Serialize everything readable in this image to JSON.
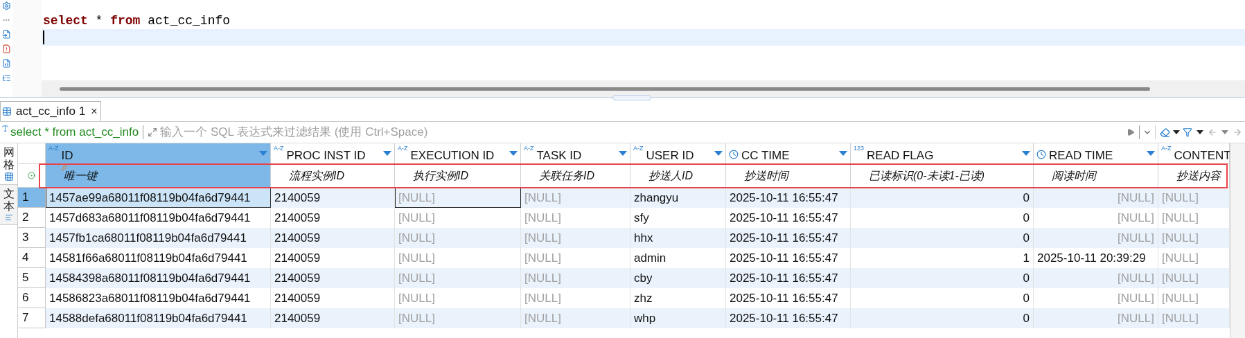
{
  "editor": {
    "lines": [
      [
        {
          "kind": "keyword",
          "text": "select"
        },
        {
          "kind": "plain",
          "text": " * "
        },
        {
          "kind": "keyword",
          "text": "from"
        },
        {
          "kind": "plain",
          "text": " act_cc_info"
        }
      ]
    ]
  },
  "results_tab": {
    "label": "act_cc_info 1",
    "close": "×"
  },
  "filter": {
    "query": "select * from act_cc_info",
    "placeholder": "输入一个 SQL 表达式来过滤结果 (使用 Ctrl+Space)"
  },
  "view_tabs": [
    {
      "label": "网格",
      "selected": true
    },
    {
      "label": "文本",
      "selected": false
    }
  ],
  "columns": [
    {
      "name": "ID",
      "kind": "text",
      "type_label": "A-Z",
      "description": "唯一键",
      "key": true,
      "selected": true
    },
    {
      "name": "PROC INST ID",
      "kind": "text",
      "type_label": "A-Z",
      "description": "流程实例ID",
      "key": false,
      "selected": false
    },
    {
      "name": "EXECUTION ID",
      "kind": "text",
      "type_label": "A-Z",
      "description": "执行实例ID",
      "key": false,
      "selected": false
    },
    {
      "name": "TASK ID",
      "kind": "text",
      "type_label": "A-Z",
      "description": "关联任务ID",
      "key": false,
      "selected": false
    },
    {
      "name": "USER ID",
      "kind": "text",
      "type_label": "A-Z",
      "description": "抄送人ID",
      "key": false,
      "selected": false
    },
    {
      "name": "CC TIME",
      "kind": "datetime",
      "description": "抄送时间",
      "key": false,
      "selected": false
    },
    {
      "name": "READ FLAG",
      "kind": "number",
      "type_label": "123",
      "description": "已读标识(0-未读1-已读)",
      "key": false,
      "selected": false
    },
    {
      "name": "READ TIME",
      "kind": "datetime",
      "description": "阅读时间",
      "key": false,
      "selected": false
    },
    {
      "name": "CONTENT",
      "kind": "text",
      "type_label": "A-Z",
      "description": "抄送内容",
      "key": false,
      "selected": false
    }
  ],
  "rows": [
    {
      "number": "1",
      "selected": true,
      "cells": [
        "1457ae99a68011f08119b04fa6d79441",
        "2140059",
        {
          "text": "[NULL]",
          "null": true,
          "focused": true
        },
        {
          "text": "[NULL]",
          "null": true
        },
        "zhangyu",
        "2025-10-11 16:55:47",
        "0",
        {
          "text": "[NULL]",
          "null": true
        },
        {
          "text": "[NULL]",
          "null": true
        }
      ]
    },
    {
      "number": "2",
      "selected": false,
      "cells": [
        "1457d683a68011f08119b04fa6d79441",
        "2140059",
        {
          "text": "[NULL]",
          "null": true
        },
        {
          "text": "[NULL]",
          "null": true
        },
        "sfy",
        "2025-10-11 16:55:47",
        "0",
        {
          "text": "[NULL]",
          "null": true
        },
        {
          "text": "[NULL]",
          "null": true
        }
      ]
    },
    {
      "number": "3",
      "selected": false,
      "cells": [
        "1457fb1ca68011f08119b04fa6d79441",
        "2140059",
        {
          "text": "[NULL]",
          "null": true
        },
        {
          "text": "[NULL]",
          "null": true
        },
        "hhx",
        "2025-10-11 16:55:47",
        "0",
        {
          "text": "[NULL]",
          "null": true
        },
        {
          "text": "[NULL]",
          "null": true
        }
      ]
    },
    {
      "number": "4",
      "selected": false,
      "cells": [
        "14581f66a68011f08119b04fa6d79441",
        "2140059",
        {
          "text": "[NULL]",
          "null": true
        },
        {
          "text": "[NULL]",
          "null": true
        },
        "admin",
        "2025-10-11 16:55:47",
        "1",
        "2025-10-11 20:39:29",
        {
          "text": "[NULL]",
          "null": true
        }
      ]
    },
    {
      "number": "5",
      "selected": false,
      "cells": [
        "14584398a68011f08119b04fa6d79441",
        "2140059",
        {
          "text": "[NULL]",
          "null": true
        },
        {
          "text": "[NULL]",
          "null": true
        },
        "cby",
        "2025-10-11 16:55:47",
        "0",
        {
          "text": "[NULL]",
          "null": true
        },
        {
          "text": "[NULL]",
          "null": true
        }
      ]
    },
    {
      "number": "6",
      "selected": false,
      "cells": [
        "14586823a68011f08119b04fa6d79441",
        "2140059",
        {
          "text": "[NULL]",
          "null": true
        },
        {
          "text": "[NULL]",
          "null": true
        },
        "zhz",
        "2025-10-11 16:55:47",
        "0",
        {
          "text": "[NULL]",
          "null": true
        },
        {
          "text": "[NULL]",
          "null": true
        }
      ]
    },
    {
      "number": "7",
      "selected": false,
      "cells": [
        "14588defa68011f08119b04fa6d79441",
        "2140059",
        {
          "text": "[NULL]",
          "null": true
        },
        {
          "text": "[NULL]",
          "null": true
        },
        "whp",
        "2025-10-11 16:55:47",
        "0",
        {
          "text": "[NULL]",
          "null": true
        },
        {
          "text": "[NULL]",
          "null": true
        }
      ]
    }
  ]
}
